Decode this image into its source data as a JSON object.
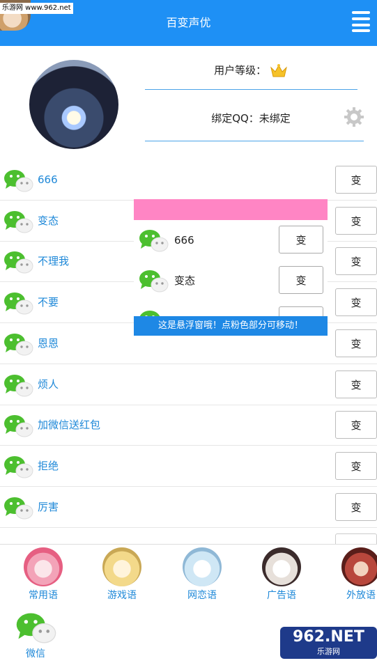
{
  "header": {
    "title": "百变声优",
    "watermark": "乐游网 www.962.net"
  },
  "profile": {
    "level_label": "用户等级：",
    "qq_label": "绑定QQ：未绑定"
  },
  "list": [
    {
      "label": "666",
      "button": "变"
    },
    {
      "label": "变态",
      "button": "变"
    },
    {
      "label": "不理我",
      "button": "变"
    },
    {
      "label": "不要",
      "button": "变"
    },
    {
      "label": "恩恩",
      "button": "变"
    },
    {
      "label": "烦人",
      "button": "变"
    },
    {
      "label": "加微信送红包",
      "button": "变"
    },
    {
      "label": "拒绝",
      "button": "变"
    },
    {
      "label": "厉害",
      "button": "变"
    }
  ],
  "float_window": {
    "items": [
      {
        "label": "666",
        "button": "变"
      },
      {
        "label": "变态",
        "button": "变"
      }
    ],
    "tip": "这是悬浮窗哦！点粉色部分可移动！",
    "drag_color": "#ff85c4"
  },
  "bottom_nav": [
    {
      "label": "常用语"
    },
    {
      "label": "游戏语"
    },
    {
      "label": "网恋语"
    },
    {
      "label": "广告语"
    },
    {
      "label": "外放语"
    },
    {
      "label": "微信"
    }
  ],
  "watermark_bottom": {
    "big": "962.NET",
    "small": "乐游网"
  },
  "colors": {
    "accent": "#1e90f5",
    "label_blue": "#1e88d8",
    "wechat_green": "#4cbf2f"
  }
}
